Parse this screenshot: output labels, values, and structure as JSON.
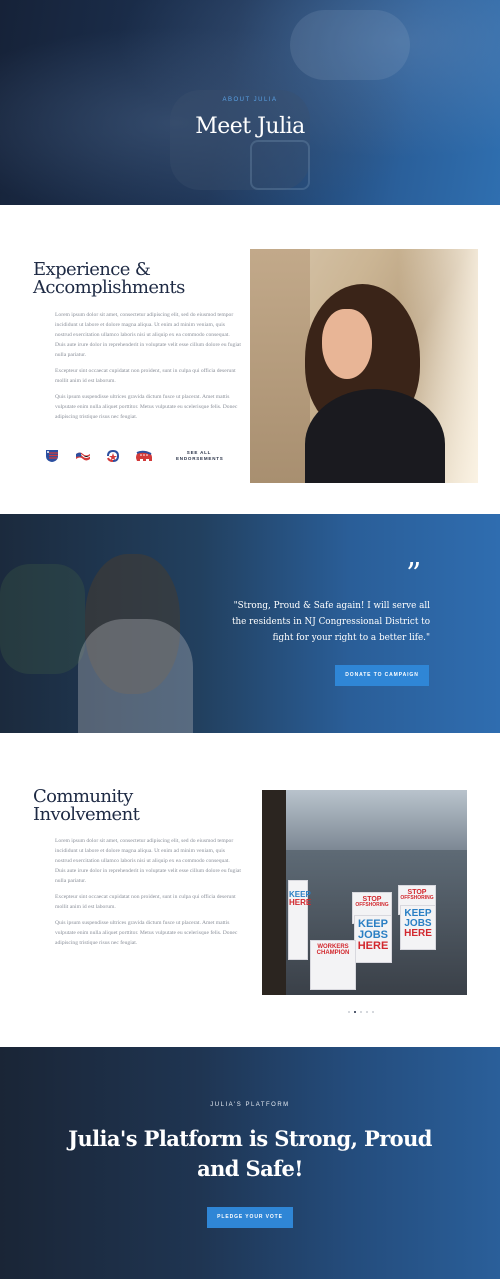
{
  "hero": {
    "eyebrow": "ABOUT JULIA",
    "title": "Meet Julia"
  },
  "experience": {
    "title_line1": "Experience &",
    "title_line2": "Accomplishments",
    "paragraphs": [
      "Lorem ipsum dolor sit amet, consectetur adipiscing elit, sed do eiusmod tempor incididunt ut labore et dolore magna aliqua. Ut enim ad minim veniam, quis nostrud exercitation ullamco laboris nisi ut aliquip ex ea commodo consequat. Duis aute irure dolor in reprehenderit in voluptate velit esse cillum dolore eu fugiat nulla pariatur.",
      "Excepteur sint occaecat cupidatat non proident, sunt in culpa qui officia deserunt mollit anim id est laborum.",
      "Quis ipsum suspendisse ultrices gravida dictum fusce ut placerat. Amet mattis vulputate enim nulla aliquet porttitor. Metus vulputate eu scelerisque felis. Donec adipiscing tristique risus nec feugiat."
    ],
    "see_all_line1": "SEE ALL",
    "see_all_line2": "ENDORSEMENTS",
    "logos": [
      "flag-shield-logo",
      "flag-wave-logo",
      "star-swirl-logo",
      "elephant-logo"
    ]
  },
  "quote": {
    "mark": "”",
    "text": "\"Strong, Proud & Safe again! I will serve all the residents in NJ Congressional District to fight for your right to a better life.\"",
    "button": "DONATE TO CAMPAIGN"
  },
  "community": {
    "title_line1": "Community",
    "title_line2": "Involvement",
    "paragraphs": [
      "Lorem ipsum dolor sit amet, consectetur adipiscing elit, sed do eiusmod tempor incididunt ut labore et dolore magna aliqua. Ut enim ad minim veniam, quis nostrud exercitation ullamco laboris nisi ut aliquip ex ea commodo consequat. Duis aute irure dolor in reprehenderit in voluptate velit esse cillum dolore eu fugiat nulla pariatur.",
      "Excepteur sint occaecat cupidatat non proident, sunt in culpa qui officia deserunt mollit anim id est laborum.",
      "Quis ipsum suspendisse ultrices gravida dictum fusce ut placerat. Amet mattis vulputate enim nulla aliquet porttitor. Metus vulputate eu scelerisque felis. Donec adipiscing tristique risus nec feugiat."
    ],
    "signs": {
      "stop": "STOP",
      "offshoring": "OFFSHORING",
      "keep": "KEEP",
      "jobs": "JOBS",
      "here": "HERE",
      "workers": "WORKERS",
      "champion": "CHAMPION"
    },
    "carousel_pages": 5,
    "carousel_active": 2
  },
  "platform": {
    "eyebrow": "JULIA'S PLATFORM",
    "title": "Julia's Platform is Strong, Proud and Safe!",
    "button": "PLEDGE YOUR VOTE"
  },
  "colors": {
    "accent": "#2f86d6",
    "heading": "#1e2a44",
    "eyebrow_blue": "#5aa2e6",
    "body_gray": "#8a8f99"
  }
}
